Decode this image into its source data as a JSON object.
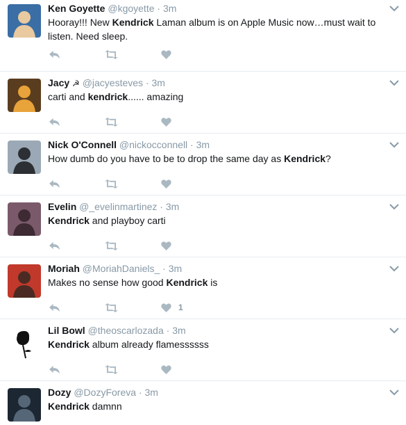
{
  "tweets": [
    {
      "name": "Ken Goyette",
      "badge": "",
      "handle": "@kgoyette",
      "time": "3m",
      "segments": [
        {
          "t": "Hooray!!! New ",
          "b": false
        },
        {
          "t": "Kendrick",
          "b": true
        },
        {
          "t": " Laman album is on Apple Music now…must wait to listen. Need sleep.",
          "b": false
        }
      ],
      "like_count": "",
      "avatar_colors": [
        "#3a6ea5",
        "#e8c9a0"
      ]
    },
    {
      "name": "Jacy",
      "badge": "☭",
      "handle": "@jacyesteves",
      "time": "3m",
      "segments": [
        {
          "t": "carti and ",
          "b": false
        },
        {
          "t": "kendrick",
          "b": true
        },
        {
          "t": "...... amazing",
          "b": false
        }
      ],
      "like_count": "",
      "avatar_colors": [
        "#5a3d1f",
        "#e8a33a"
      ]
    },
    {
      "name": "Nick O'Connell",
      "badge": "",
      "handle": "@nickocconnell",
      "time": "3m",
      "segments": [
        {
          "t": "How dumb do you have to be to drop the same day as ",
          "b": false
        },
        {
          "t": "Kendrick",
          "b": true
        },
        {
          "t": "?",
          "b": false
        }
      ],
      "like_count": "",
      "avatar_colors": [
        "#9aa9b5",
        "#2c2f33"
      ]
    },
    {
      "name": "Evelin",
      "badge": "",
      "handle": "@_evelinmartinez",
      "time": "3m",
      "segments": [
        {
          "t": "Kendrick",
          "b": true
        },
        {
          "t": " and playboy carti",
          "b": false
        }
      ],
      "like_count": "",
      "avatar_colors": [
        "#7a5a6a",
        "#3d2a33"
      ]
    },
    {
      "name": "Moriah",
      "badge": "",
      "handle": "@MoriahDaniels_",
      "time": "3m",
      "segments": [
        {
          "t": "Makes no sense how good ",
          "b": false
        },
        {
          "t": "Kendrick",
          "b": true
        },
        {
          "t": " is",
          "b": false
        }
      ],
      "like_count": "1",
      "avatar_colors": [
        "#c0392b",
        "#4a2a22"
      ]
    },
    {
      "name": "Lil Bowl",
      "badge": "",
      "handle": "@theoscarlozada",
      "time": "3m",
      "segments": [
        {
          "t": "Kendrick",
          "b": true
        },
        {
          "t": " album already flamessssss",
          "b": false
        }
      ],
      "like_count": "",
      "avatar_colors": [
        "#ffffff",
        "#111111"
      ]
    },
    {
      "name": "Dozy",
      "badge": "",
      "handle": "@DozyForeva",
      "time": "3m",
      "segments": [
        {
          "t": "Kendrick",
          "b": true
        },
        {
          "t": " damnn",
          "b": false
        }
      ],
      "like_count": "",
      "avatar_colors": [
        "#1c2733",
        "#556677"
      ]
    }
  ],
  "colors": {
    "icon": "#aab8c2",
    "caret": "#8899a6",
    "divider": "#e6ecf0"
  }
}
